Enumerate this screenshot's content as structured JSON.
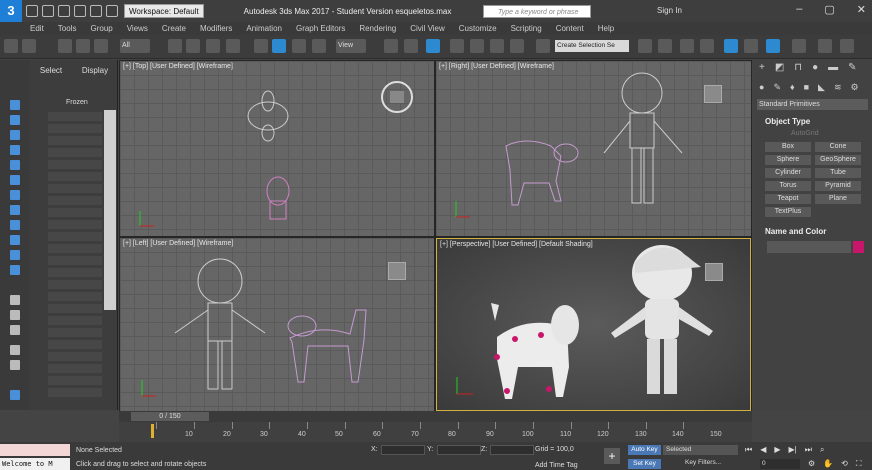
{
  "titlebar": {
    "logo": "3",
    "workspace": "Workspace: Default",
    "title": "Autodesk 3ds Max 2017 - Student Version   esqueletos.max",
    "search_placeholder": "Type a keyword or phrase",
    "signin": "Sign In"
  },
  "menu": [
    "Edit",
    "Tools",
    "Group",
    "Views",
    "Create",
    "Modifiers",
    "Animation",
    "Graph Editors",
    "Rendering",
    "Civil View",
    "Customize",
    "Scripting",
    "Content",
    "Help"
  ],
  "toolbar": {
    "filter": "All",
    "view": "View",
    "selection_set": "Create Selection Se"
  },
  "scene_explorer": {
    "tabs": [
      "Select",
      "Display"
    ],
    "frozen_label": "Frozen"
  },
  "viewports": [
    {
      "label": "[+] [Top] [User Defined] [Wireframe]"
    },
    {
      "label": "[+] [Right] [User Defined] [Wireframe]"
    },
    {
      "label": "[+] [Left] [User Defined] [Wireframe]"
    },
    {
      "label": "[+] [Perspective] [User Defined] [Default Shading]"
    }
  ],
  "command_panel": {
    "category": "Standard Primitives",
    "object_type_title": "Object Type",
    "autogrid": "AutoGrid",
    "primitives": [
      "Box",
      "Cone",
      "Sphere",
      "GeoSphere",
      "Cylinder",
      "Tube",
      "Torus",
      "Pyramid",
      "Teapot",
      "Plane",
      "TextPlus"
    ],
    "name_color_title": "Name and Color",
    "color_hex": "#c8176a"
  },
  "timeline": {
    "slider": "0 / 150",
    "ticks": [
      "10",
      "20",
      "30",
      "40",
      "50",
      "60",
      "70",
      "80",
      "90",
      "100",
      "110",
      "120",
      "130",
      "140",
      "150"
    ]
  },
  "status": {
    "maxscript": "Welcome to M",
    "selection": "None Selected",
    "prompt": "Click and drag to select and rotate objects",
    "x_label": "X:",
    "y_label": "Y:",
    "z_label": "Z:",
    "grid": "Grid = 100,0",
    "add_time_tag": "Add Time Tag",
    "auto_key": "Auto Key",
    "set_key": "Set Key",
    "selected": "Selected",
    "key_filters": "Key Filters...",
    "frame": "0"
  }
}
